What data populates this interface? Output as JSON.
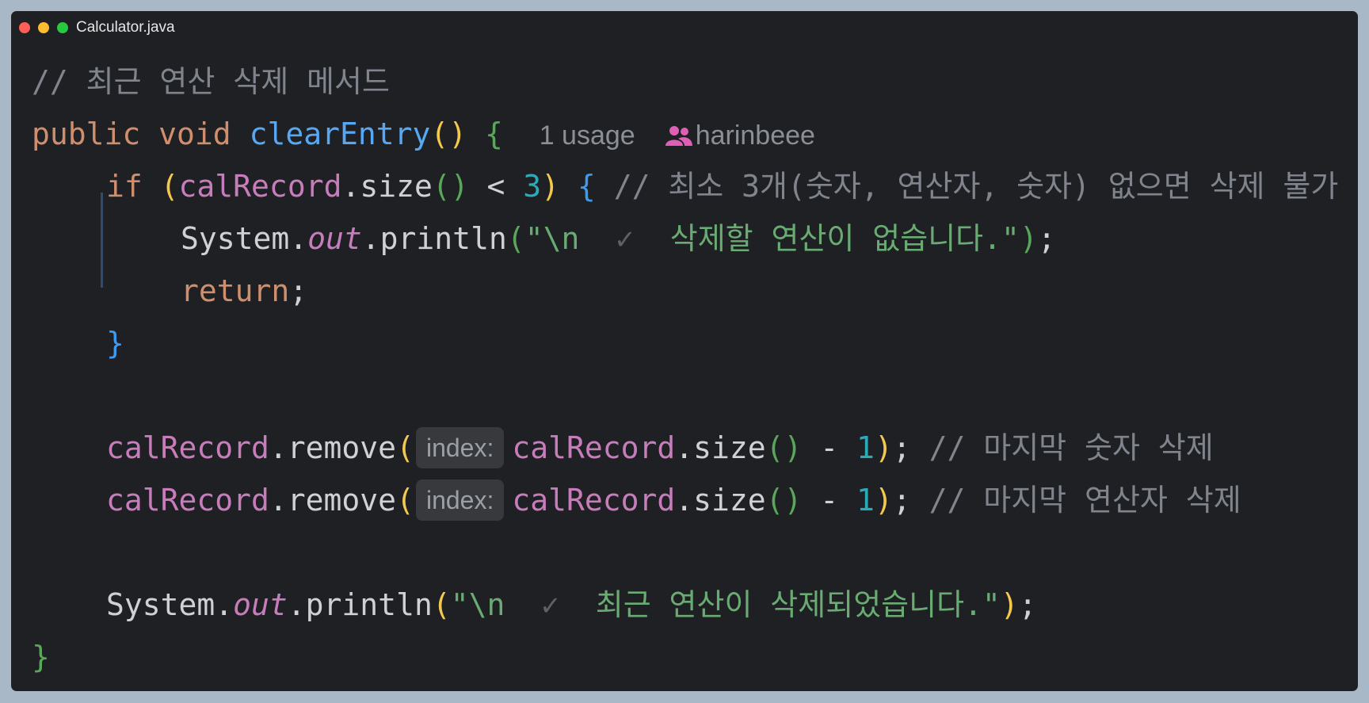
{
  "window": {
    "title": "Calculator.java"
  },
  "code": {
    "line1_comment": "// 최근 연산 삭제 메서드",
    "line2": {
      "kw_public": "public",
      "kw_void": "void",
      "method": "clearEntry",
      "paren_open": "(",
      "paren_close": ")",
      "brace": "{",
      "usages": "1 usage",
      "author": "harinbeee"
    },
    "line3": {
      "kw_if": "if",
      "paren_open": "(",
      "field": "calRecord",
      "dot_call": ".size",
      "call_parens": "()",
      "op": " < ",
      "num": "3",
      "paren_close": ")",
      "brace": "{",
      "comment": "// 최소 3개(숫자, 연산자, 숫자) 없으면 삭제 불가"
    },
    "line4": {
      "cls": "System.",
      "out": "out",
      "call": ".println",
      "paren_open": "(",
      "str_start": "\"\\n  ",
      "check": "✓",
      "str_end": "  삭제할 연산이 없습니다.\"",
      "paren_close": ")",
      "semi": ";"
    },
    "line5": {
      "kw_return": "return",
      "semi": ";"
    },
    "line6": {
      "brace": "}"
    },
    "line8": {
      "field": "calRecord",
      "call": ".remove",
      "paren_open": "(",
      "hint": "index:",
      "field2": "calRecord",
      "call2": ".size",
      "parens2": "()",
      "op": " - ",
      "num": "1",
      "paren_close": ")",
      "semi": ";",
      "comment": "// 마지막 숫자 삭제"
    },
    "line9": {
      "field": "calRecord",
      "call": ".remove",
      "paren_open": "(",
      "hint": "index:",
      "field2": "calRecord",
      "call2": ".size",
      "parens2": "()",
      "op": " - ",
      "num": "1",
      "paren_close": ")",
      "semi": ";",
      "comment": "// 마지막 연산자 삭제"
    },
    "line11": {
      "cls": "System.",
      "out": "out",
      "call": ".println",
      "paren_open": "(",
      "str_start": "\"\\n  ",
      "check": "✓",
      "str_end": "  최근 연산이 삭제되었습니다.\"",
      "paren_close": ")",
      "semi": ";"
    },
    "line12": {
      "brace": "}"
    }
  },
  "colors": {
    "background": "#1f2023",
    "comment": "#7f848d",
    "keyword": "#cf8e6d",
    "method": "#56a8f5",
    "field": "#c77dbb",
    "string": "#6aab73",
    "number": "#2aacb8"
  }
}
